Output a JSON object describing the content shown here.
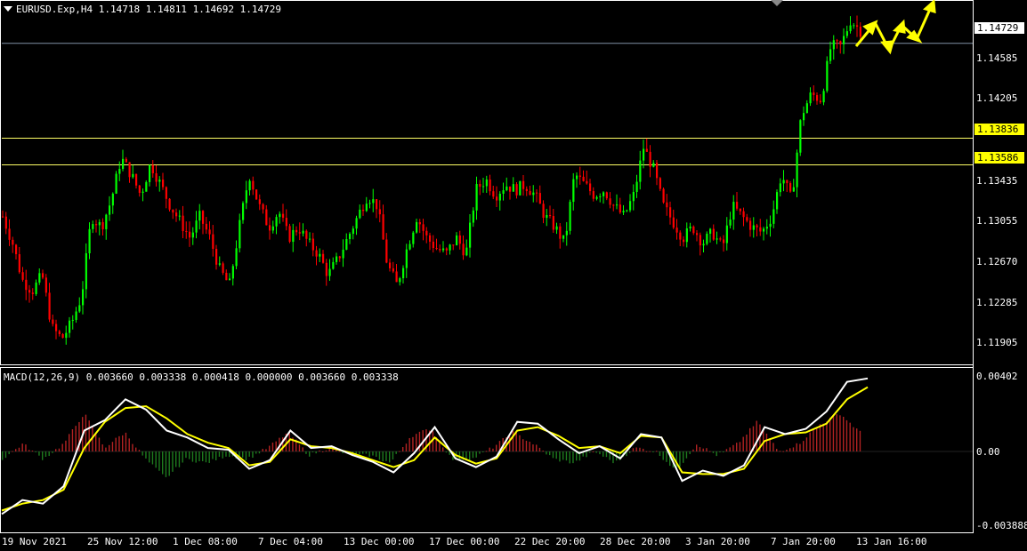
{
  "chart_header": {
    "symbol_info": "EURUSD.Exp,H4  1.14718 1.14811 1.14692 1.14729"
  },
  "indicator_header": {
    "text": "MACD(12,26,9) 0.003660 0.003338 0.000418 0.000000 0.003660 0.003338"
  },
  "colors": {
    "background": "#000000",
    "bull_candle": "#00ff00",
    "bear_candle": "#ff0000",
    "level_line": "#ffff66",
    "current_price_line": "#7f8fa6",
    "macd_line": "#ffffff",
    "signal_line": "#ffff00",
    "arrows": "#ffff00"
  },
  "price_axis": {
    "ticks": [
      "1.14585",
      "1.14205",
      "1.13435",
      "1.13055",
      "1.12670",
      "1.12285",
      "1.11905"
    ],
    "ymin": 1.1175,
    "ymax": 1.1507
  },
  "price_labels": {
    "current": "1.14729",
    "level_upper": "1.13836",
    "level_lower": "1.13586"
  },
  "macd_axis": {
    "ticks": [
      "0.00402",
      "0.00",
      "-0.003888"
    ],
    "ymin": -0.0045,
    "ymax": 0.0046
  },
  "time_axis": {
    "ticks": [
      "19 Nov 2021",
      "25 Nov 12:00",
      "1 Dec 08:00",
      "7 Dec 04:00",
      "13 Dec 00:00",
      "17 Dec 00:00",
      "22 Dec 20:00",
      "28 Dec 20:00",
      "3 Jan 20:00",
      "7 Jan 20:00",
      "13 Jan 16:00"
    ]
  },
  "chart_data": [
    {
      "type": "candlestick",
      "title": "EURUSD.Exp,H4",
      "y_range": [
        1.1175,
        1.1507
      ],
      "levels": [
        1.14729,
        1.13836,
        1.13586
      ],
      "close_path": [
        1.131,
        1.1285,
        1.125,
        1.124,
        1.1255,
        1.1205,
        1.1195,
        1.121,
        1.1235,
        1.131,
        1.13,
        1.1325,
        1.1365,
        1.135,
        1.133,
        1.136,
        1.134,
        1.132,
        1.1305,
        1.129,
        1.131,
        1.129,
        1.126,
        1.1245,
        1.13,
        1.135,
        1.132,
        1.13,
        1.1315,
        1.129,
        1.13,
        1.1285,
        1.1275,
        1.1255,
        1.127,
        1.129,
        1.131,
        1.133,
        1.132,
        1.1265,
        1.1245,
        1.128,
        1.131,
        1.129,
        1.128,
        1.1275,
        1.129,
        1.1275,
        1.1335,
        1.1345,
        1.133,
        1.134,
        1.1335,
        1.134,
        1.133,
        1.131,
        1.13,
        1.1285,
        1.135,
        1.134,
        1.133,
        1.1335,
        1.132,
        1.131,
        1.133,
        1.1375,
        1.1355,
        1.132,
        1.1305,
        1.129,
        1.13,
        1.1285,
        1.1295,
        1.128,
        1.132,
        1.131,
        1.13,
        1.1295,
        1.131,
        1.135,
        1.1325,
        1.1405,
        1.1425,
        1.142,
        1.147,
        1.147,
        1.1495,
        1.1485
      ],
      "macd_line": [
        -0.0036,
        -0.0028,
        -0.003,
        -0.002,
        0.0012,
        0.0018,
        0.003,
        0.0024,
        0.0012,
        0.0008,
        0.0002,
        0.0001,
        -0.001,
        -0.0005,
        0.0012,
        0.0002,
        0.0003,
        -0.0002,
        -0.0006,
        -0.0012,
        -0.0001,
        0.0014,
        -0.0004,
        -0.0009,
        -0.0003,
        0.0017,
        0.0016,
        0.0007,
        -0.0001,
        0.0003,
        -0.0004,
        0.001,
        0.0008,
        -0.0017,
        -0.0011,
        -0.0014,
        -0.0008,
        0.0014,
        0.001,
        0.0013,
        0.0023,
        0.004,
        0.0042
      ],
      "signal_line": [
        -0.0034,
        -0.003,
        -0.0028,
        -0.0022,
        0.0002,
        0.0017,
        0.0025,
        0.0026,
        0.0019,
        0.001,
        0.0005,
        0.0002,
        -0.0008,
        -0.0006,
        0.0007,
        0.0003,
        0.0002,
        -0.0001,
        -0.0005,
        -0.0009,
        -0.0005,
        0.0008,
        -0.0002,
        -0.0007,
        -0.0004,
        0.0012,
        0.0014,
        0.0009,
        0.0002,
        0.0003,
        -0.0001,
        0.0009,
        0.0008,
        -0.0012,
        -0.0013,
        -0.0013,
        -0.001,
        0.0006,
        0.001,
        0.0011,
        0.0016,
        0.003,
        0.0037
      ]
    }
  ]
}
